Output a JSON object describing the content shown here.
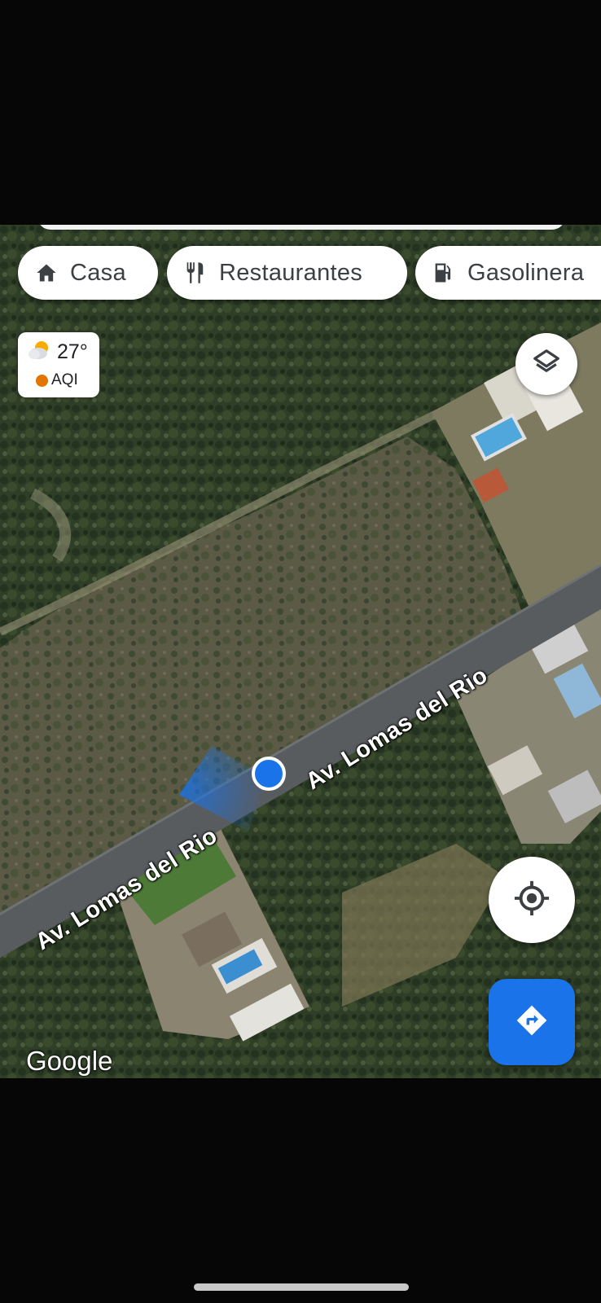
{
  "shortcuts": [
    {
      "label": "Casa",
      "icon": "home-icon"
    },
    {
      "label": "Restaurantes",
      "icon": "restaurant-icon"
    },
    {
      "label": "Gasolinera",
      "icon": "gas-station-icon"
    }
  ],
  "weather": {
    "temperature": "27°",
    "aqi_label": "AQI",
    "icon": "partly-cloudy-icon",
    "aqi_color": "#e37400"
  },
  "map": {
    "street_labels": [
      "Av. Lomas del Rio",
      "Av. Lomas del Rio"
    ],
    "attribution": "Google",
    "layer_button_icon": "layers-icon",
    "locate_button_icon": "my-location-icon",
    "directions_button_icon": "directions-icon"
  },
  "colors": {
    "accent": "#1a73e8",
    "location_dot": "#1a73e8"
  }
}
